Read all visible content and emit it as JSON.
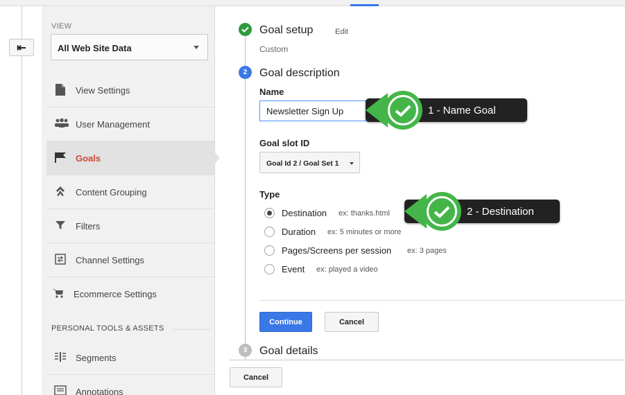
{
  "sidebar": {
    "view_label": "VIEW",
    "view_select_value": "All Web Site Data",
    "items": [
      {
        "label": "View Settings",
        "icon": "document-icon"
      },
      {
        "label": "User Management",
        "icon": "users-icon"
      },
      {
        "label": "Goals",
        "icon": "flag-icon",
        "active": true
      },
      {
        "label": "Content Grouping",
        "icon": "grouping-icon"
      },
      {
        "label": "Filters",
        "icon": "filter-icon"
      },
      {
        "label": "Channel Settings",
        "icon": "channel-icon"
      },
      {
        "label": "Ecommerce Settings",
        "icon": "cart-icon"
      }
    ],
    "section_heading": "PERSONAL TOOLS & ASSETS",
    "tools": [
      {
        "label": "Segments",
        "icon": "segments-icon"
      },
      {
        "label": "Annotations",
        "icon": "annotations-icon"
      }
    ]
  },
  "steps": {
    "setup": {
      "title": "Goal setup",
      "edit": "Edit",
      "sub": "Custom"
    },
    "description": {
      "number": "2",
      "title": "Goal description"
    },
    "details": {
      "number": "3",
      "title": "Goal details"
    }
  },
  "form": {
    "name_label": "Name",
    "name_value": "Newsletter Sign Up",
    "slot_label": "Goal slot ID",
    "slot_value": "Goal Id 2 / Goal Set 1",
    "type_label": "Type",
    "types": [
      {
        "label": "Destination",
        "example": "ex: thanks.html",
        "checked": true
      },
      {
        "label": "Duration",
        "example": "ex: 5 minutes or more",
        "checked": false
      },
      {
        "label": "Pages/Screens per session",
        "example": "ex: 3 pages",
        "checked": false
      },
      {
        "label": "Event",
        "example": "ex: played a video",
        "checked": false
      }
    ],
    "continue_label": "Continue",
    "cancel_label": "Cancel"
  },
  "bottom_cancel_label": "Cancel",
  "callouts": [
    {
      "text": "1 - Name Goal"
    },
    {
      "text": "2 - Destination"
    }
  ],
  "colors": {
    "accent": "#3b78e7",
    "active_nav": "#d14836",
    "done": "#2e9a3f",
    "callout_badge": "#44b649"
  }
}
